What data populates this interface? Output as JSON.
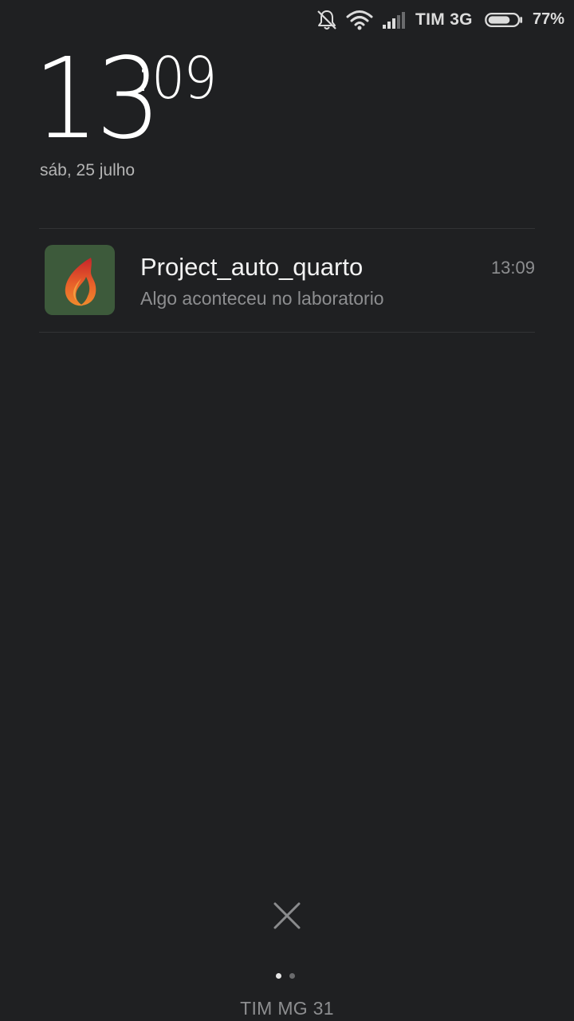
{
  "status_bar": {
    "icons": [
      "bell-off-icon",
      "wifi-icon",
      "cellular-signal-icon",
      "battery-icon"
    ],
    "carrier": "TIM 3G",
    "battery_percent": "77%",
    "battery_level": 0.77
  },
  "lockscreen": {
    "clock_hours": "13",
    "clock_separator": ":",
    "clock_minutes": "09",
    "date": "sáb, 25 julho"
  },
  "notifications": [
    {
      "app_icon": "flame-icon",
      "title": "Project_auto_quarto",
      "text": "Algo aconteceu no laboratorio",
      "time": "13:09"
    }
  ],
  "bottom": {
    "close_icon": "close-icon",
    "page_indicator": {
      "count": 2,
      "active": 0
    },
    "carrier_label": "TIM MG 31"
  },
  "colors": {
    "background": "#1f2022",
    "primary_text": "#ffffff",
    "secondary_text": "#8d8e90",
    "app_icon_bg": "#3d5a3b",
    "flame_orange": "#e8612a"
  }
}
